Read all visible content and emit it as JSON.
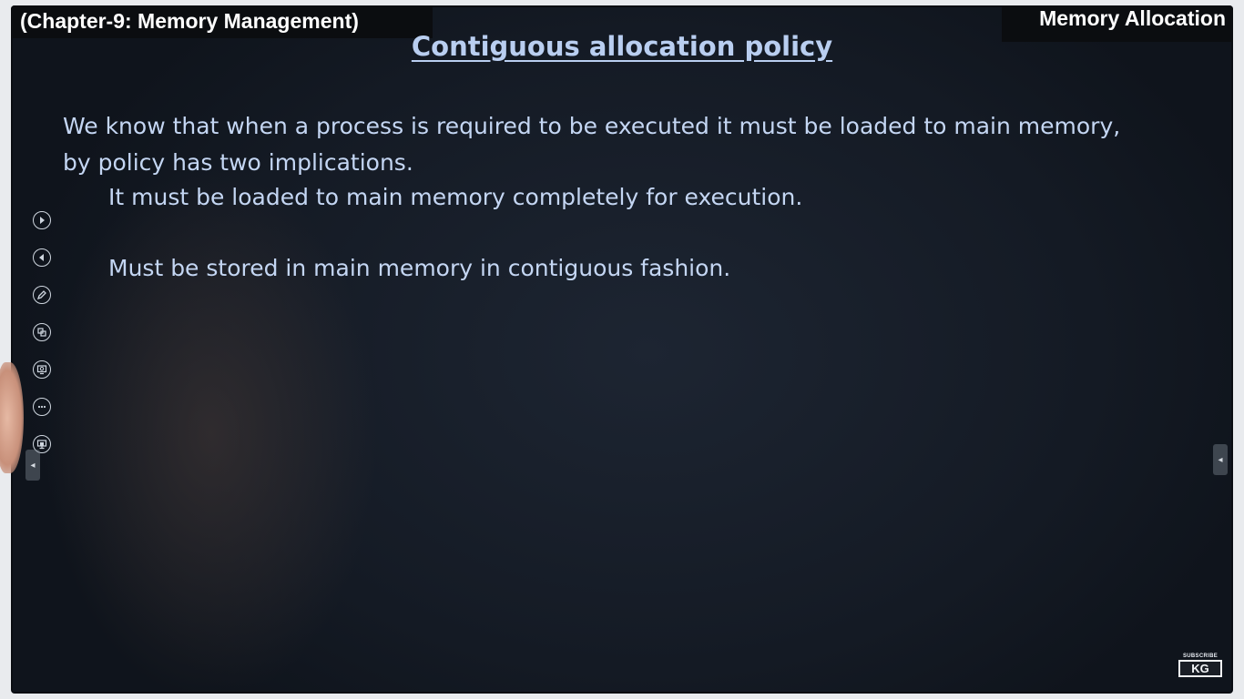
{
  "header": {
    "chapter": "(Chapter-9: Memory Management)",
    "topic": "Memory Allocation"
  },
  "slide": {
    "title": "Contiguous allocation policy",
    "paragraph_line1": "We know that when a process is required to be executed it must be loaded to main memory,",
    "paragraph_line2": "by policy has two implications.",
    "bullets": [
      "It must be loaded to main memory completely for execution.",
      "Must be stored in main memory in contiguous fashion."
    ]
  },
  "toolbar": {
    "icons": [
      "next-icon",
      "previous-icon",
      "pen-icon",
      "slides-icon",
      "zoom-icon",
      "more-icon",
      "screen-icon"
    ]
  },
  "logo": {
    "subtitle": "SUBSCRIBE",
    "text": "KG"
  },
  "colors": {
    "board": "#141a24",
    "text": "#c4d6f3",
    "title": "#b9cef0",
    "bar": "#0b0d10"
  }
}
